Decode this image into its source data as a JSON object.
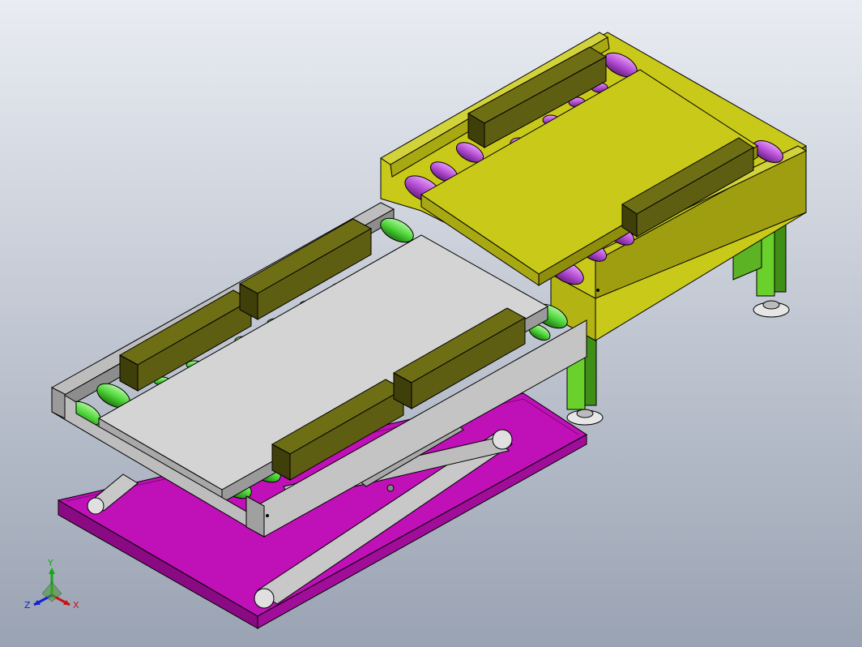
{
  "viewport": {
    "background_top": "#e9ecf2",
    "background_bottom": "#9aa3b3"
  },
  "model": {
    "colors": {
      "yellow_frame": "#c9c91a",
      "yellow_frame_dark": "#9e9e10",
      "yellow_top": "#d2d23a",
      "purple_roller": "#b64fd6",
      "gray_frame": "#bdbdbd",
      "gray_frame_dark": "#8d8d8d",
      "gray_plate": "#d4d4d4",
      "green_roller": "#4fd63a",
      "green_leg": "#6ad02b",
      "magenta_base": "#c010b8",
      "magenta_base_dark": "#8a0a84",
      "olive_block": "#5e5e12",
      "olive_block_dark": "#3f3f0a",
      "scissor_arm": "#c8c8c8",
      "foot": "#e6e6e6"
    }
  },
  "triad": {
    "x_label": "X",
    "y_label": "Y",
    "z_label": "Z",
    "x_color": "#cc1111",
    "y_color": "#11aa11",
    "z_color": "#1122cc"
  }
}
